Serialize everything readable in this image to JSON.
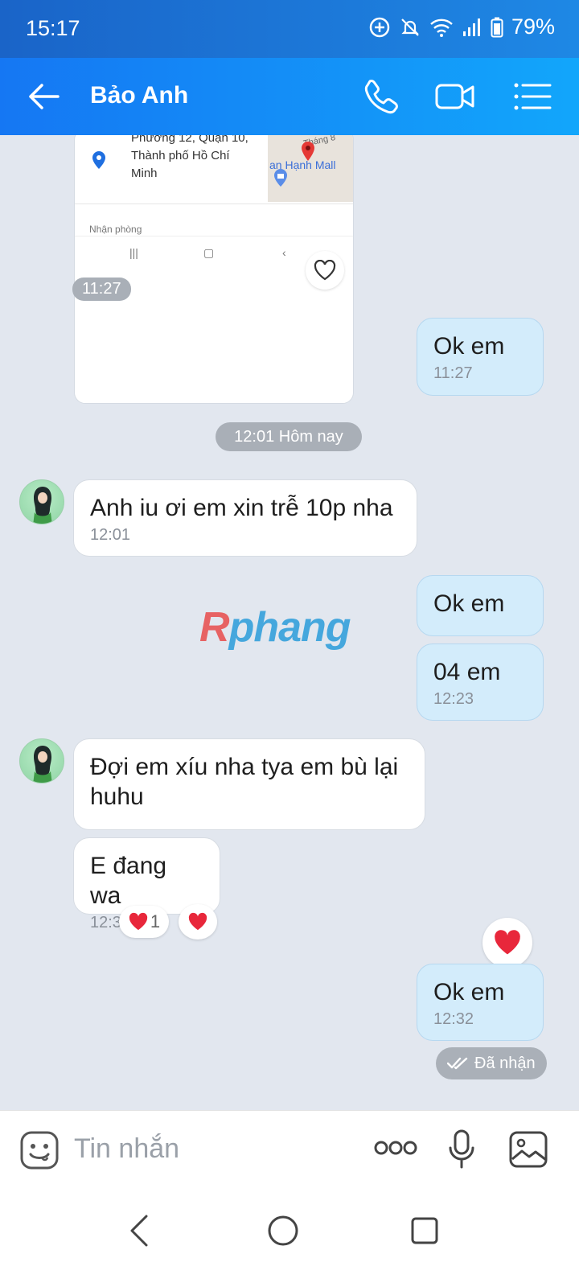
{
  "status_bar": {
    "time": "15:17",
    "battery": "79%"
  },
  "header": {
    "contact_name": "Bảo Anh"
  },
  "shared_card": {
    "address_lines": [
      "Phường 12, Quận 10,",
      "Thành phố Hồ Chí",
      "Minh"
    ],
    "map_street": "Tháng 8",
    "map_place": "an Hạnh Mall",
    "room_label": "Nhận phòng",
    "time": "11:27"
  },
  "messages": {
    "m1": {
      "text": "Ok em",
      "time": "11:27"
    },
    "date_divider": "12:01 Hôm nay",
    "m2": {
      "text": "Anh iu ơi em xin trễ 10p nha",
      "time": "12:01"
    },
    "m3": {
      "text": "Ok em"
    },
    "m4": {
      "text": "04 em",
      "time": "12:23"
    },
    "m5": {
      "text": "Đợi em xíu nha tya em bù lại huhu"
    },
    "m6": {
      "text": "E đang wa",
      "time": "12:30",
      "reaction_count": "1"
    },
    "m7": {
      "text": "Ok em",
      "time": "12:32"
    },
    "status": "Đã nhận"
  },
  "watermark": {
    "first": "R",
    "rest": "phang"
  },
  "input": {
    "placeholder": "Tin nhắn"
  },
  "colors": {
    "header_blue": "#1577f3",
    "bubble_out": "#d3ecfb",
    "heart_red": "#e8273b"
  }
}
